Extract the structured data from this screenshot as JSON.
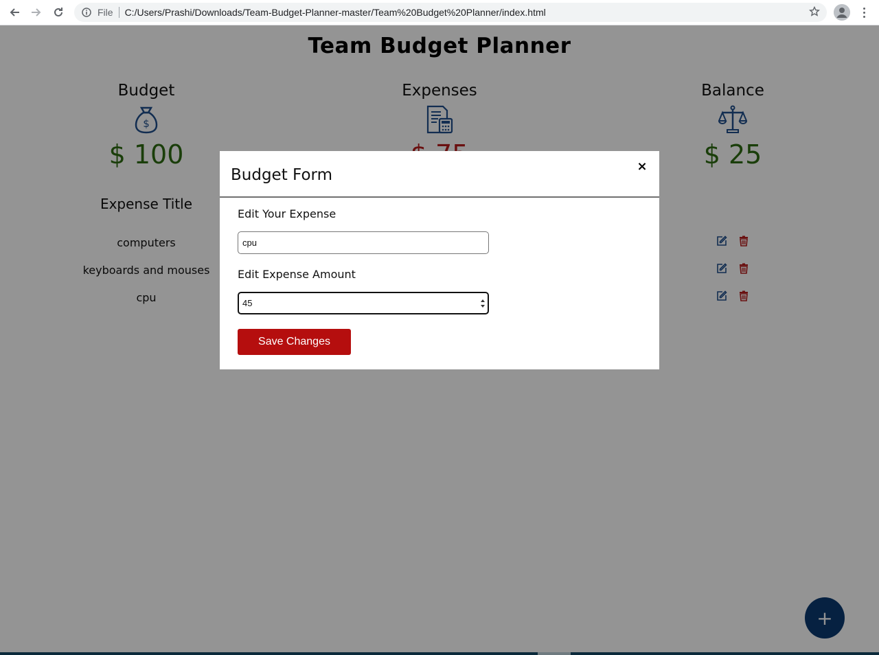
{
  "browser": {
    "file_label": "File",
    "url": "C:/Users/Prashi/Downloads/Team-Budget-Planner-master/Team%20Budget%20Planner/index.html",
    "icons": [
      "back-arrow-icon",
      "forward-arrow-icon",
      "reload-icon",
      "info-icon",
      "star-icon",
      "profile-icon",
      "more-vert-icon"
    ]
  },
  "page": {
    "title": "Team Budget Planner",
    "budget": {
      "label": "Budget",
      "amount": "$ 100",
      "icon": "money-bag-icon"
    },
    "expenses": {
      "label": "Expenses",
      "amount": "$ 75",
      "icon": "invoice-calculator-icon"
    },
    "balance": {
      "label": "Balance",
      "amount": "$ 25",
      "icon": "scales-icon"
    },
    "expense_header": "Expense Title",
    "expense_items": [
      {
        "title": "computers"
      },
      {
        "title": "keyboards and mouses"
      },
      {
        "title": "cpu"
      }
    ],
    "fab_label": "+"
  },
  "modal": {
    "title": "Budget Form",
    "close_label": "×",
    "expense_label": "Edit Your Expense",
    "expense_value": "cpu",
    "amount_label": "Edit Expense Amount",
    "amount_value": "45",
    "save_label": "Save Changes"
  },
  "colors": {
    "accent_navy": "#0b3970",
    "positive_green": "#2e6b12",
    "danger_red": "#b50e0e",
    "icon_blue": "#1f4f8c"
  }
}
